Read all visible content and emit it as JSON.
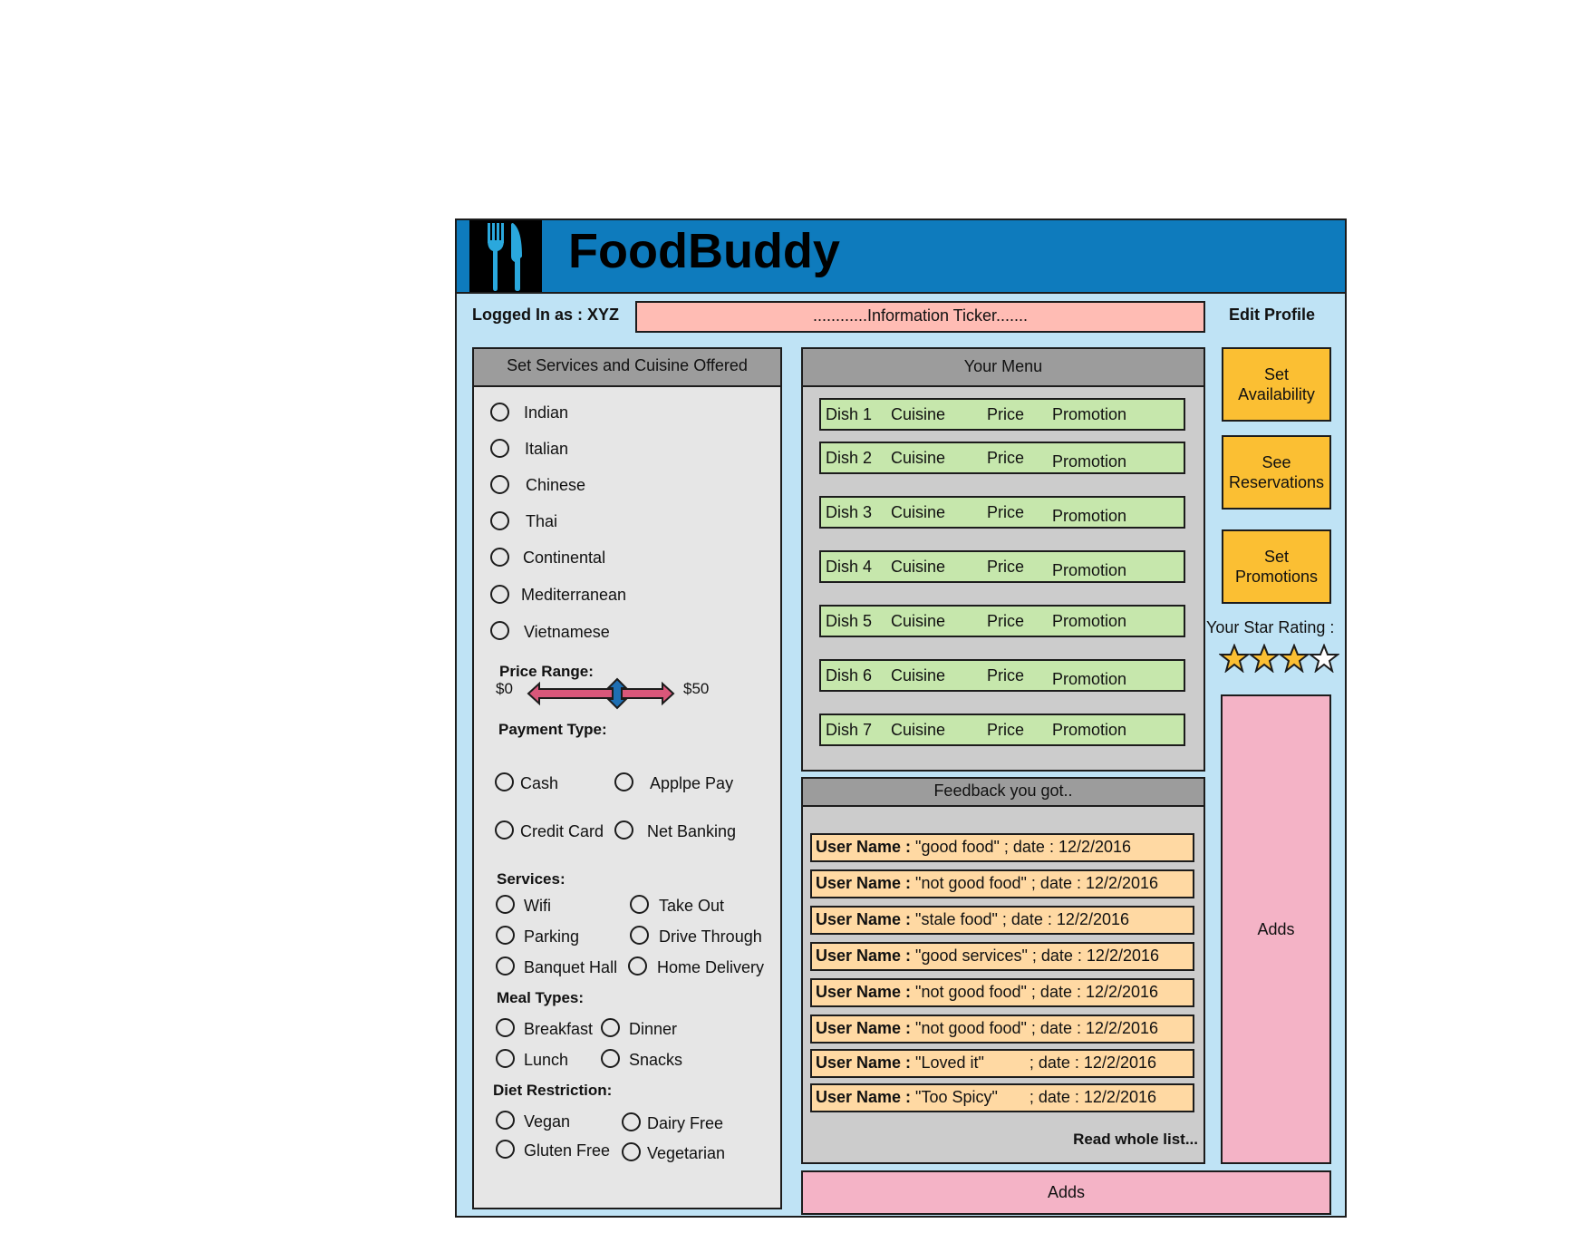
{
  "app": {
    "title": "FoodBuddy"
  },
  "header": {
    "logged_in": "Logged In as : XYZ",
    "ticker": "............Information Ticker.......",
    "edit_profile": "Edit Profile"
  },
  "services_panel": {
    "title": "Set Services and Cuisine Offered",
    "cuisines": [
      "Indian",
      "Italian",
      "Chinese",
      "Thai",
      "Continental",
      "Mediterranean",
      "Vietnamese"
    ],
    "price_range": {
      "label": "Price Range:",
      "min": "$0",
      "max": "$50"
    },
    "payment": {
      "label": "Payment Type:",
      "options": [
        "Cash",
        "Applpe Pay",
        "Credit Card",
        "Net Banking"
      ]
    },
    "services": {
      "label": "Services:",
      "options": [
        "Wifi",
        "Take Out",
        "Parking",
        "Drive Through",
        "Banquet Hall",
        "Home Delivery"
      ]
    },
    "meal_types": {
      "label": "Meal Types:",
      "options": [
        "Breakfast",
        "Dinner",
        "Lunch",
        "Snacks"
      ]
    },
    "diet": {
      "label": "Diet Restriction:",
      "options": [
        "Vegan",
        "Dairy Free",
        "Gluten Free",
        "Vegetarian"
      ]
    }
  },
  "menu": {
    "title": "Your Menu",
    "dishes": [
      {
        "name": "Dish 1",
        "cuisine": "Cuisine",
        "price": "Price",
        "promotion": "Promotion"
      },
      {
        "name": "Dish 2",
        "cuisine": "Cuisine",
        "price": "Price",
        "promotion": "Promotion"
      },
      {
        "name": "Dish 3",
        "cuisine": "Cuisine",
        "price": "Price",
        "promotion": "Promotion"
      },
      {
        "name": "Dish 4",
        "cuisine": "Cuisine",
        "price": "Price",
        "promotion": "Promotion"
      },
      {
        "name": "Dish 5",
        "cuisine": "Cuisine",
        "price": "Price",
        "promotion": "Promotion"
      },
      {
        "name": "Dish 6",
        "cuisine": "Cuisine",
        "price": "Price",
        "promotion": "Promotion"
      },
      {
        "name": "Dish 7",
        "cuisine": "Cuisine",
        "price": "Price",
        "promotion": "Promotion"
      }
    ]
  },
  "feedback": {
    "title": "Feedback you got..",
    "items": [
      {
        "user": "User Name :",
        "text": " \"good food\" ; date : 12/2/2016"
      },
      {
        "user": "User Name :",
        "text": " \"not good food\" ; date : 12/2/2016"
      },
      {
        "user": "User Name :",
        "text": " \"stale food\" ; date : 12/2/2016"
      },
      {
        "user": "User Name :",
        "text": " \"good services\" ; date : 12/2/2016"
      },
      {
        "user": "User Name :",
        "text": " \"not good food\" ; date : 12/2/2016"
      },
      {
        "user": "User Name :",
        "text": " \"not good food\" ; date : 12/2/2016"
      },
      {
        "user": "User Name :",
        "text": " \"Loved it\"          ; date : 12/2/2016"
      },
      {
        "user": "User Name :",
        "text": " \"Too Spicy\"       ; date : 12/2/2016"
      }
    ],
    "read_more": "Read whole list..."
  },
  "actions": {
    "set_availability": "Set Availability",
    "see_reservations": "See Reservations",
    "set_promotions": "Set Promotions"
  },
  "rating": {
    "label": "Your Star Rating :",
    "value": 3,
    "max": 4
  },
  "ads": {
    "side": "Adds",
    "bottom": "Adds"
  },
  "colors": {
    "header": "#0e7bbd",
    "background": "#bfe3f5",
    "button": "#fbbf33",
    "ads": "#f4b3c6",
    "ticker": "#ffbcb4",
    "dish": "#c6e7ac",
    "feedback": "#ffd9a3"
  }
}
